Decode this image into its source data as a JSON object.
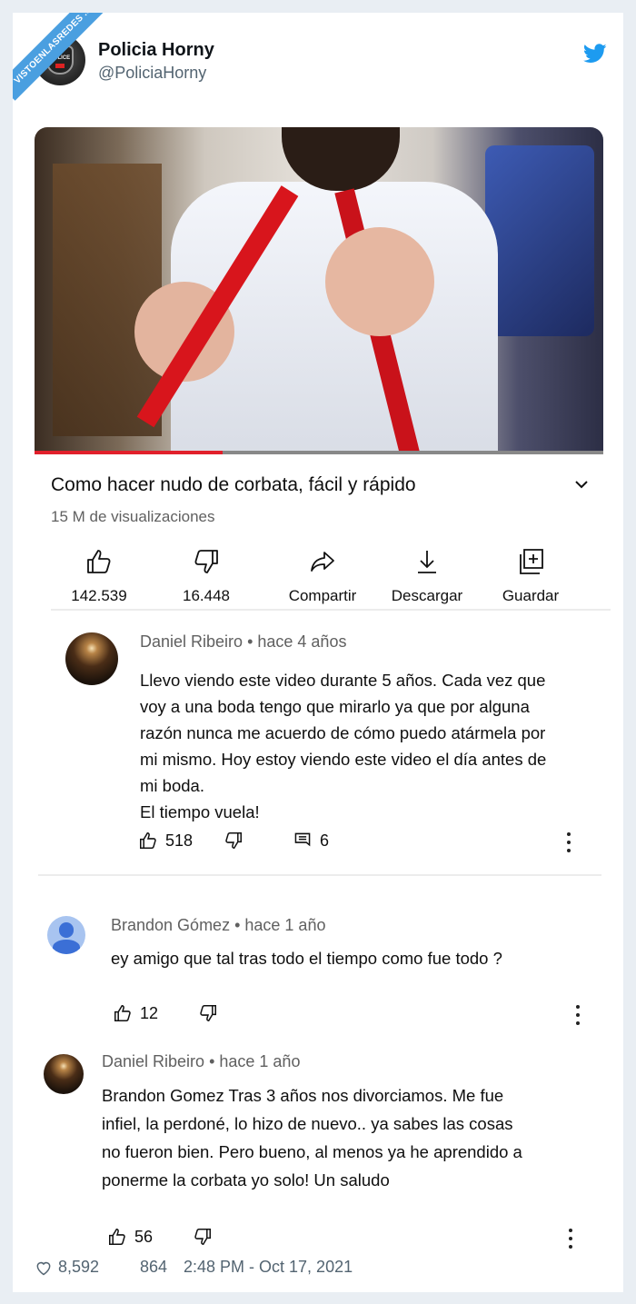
{
  "watermark": "VISTOENLASREDES .com",
  "tweet": {
    "author_name": "Policia Horny",
    "author_handle": "@PoliciaHorny",
    "avatar_badge_text": "POLICE",
    "likes": "8,592",
    "retweets": "864",
    "timestamp": "2:48 PM - Oct 17, 2021"
  },
  "video": {
    "title": "Como hacer nudo de corbata, fácil y rápido",
    "views": "15 M de visualizaciones",
    "progress": 0.33,
    "actions": [
      {
        "icon": "thumbs-up-icon",
        "label": "142.539"
      },
      {
        "icon": "thumbs-down-icon",
        "label": "16.448"
      },
      {
        "icon": "share-icon",
        "label": "Compartir"
      },
      {
        "icon": "download-icon",
        "label": "Descargar"
      },
      {
        "icon": "save-playlist-icon",
        "label": "Guardar"
      }
    ]
  },
  "comments": [
    {
      "author": "Daniel Ribeiro",
      "age": "hace 4 años",
      "text": "Llevo viendo este video durante 5 años. Cada vez que\nvoy a una boda tengo que mirarlo ya que por alguna\nrazón nunca me acuerdo de cómo puedo atármela por\nmi mismo. Hoy estoy viendo este video el día antes de\nmi boda.\nEl tiempo vuela!",
      "likes": "518",
      "replies": "6"
    },
    {
      "author": "Brandon Gómez",
      "age": "hace 1 año",
      "text": "ey amigo que tal tras todo el tiempo como fue todo ?",
      "likes": "12"
    },
    {
      "author": "Daniel Ribeiro",
      "age": "hace 1 año",
      "text": "Brandon Gomez Tras 3 años nos divorciamos. Me fue\ninfiel, la perdoné, lo hizo de nuevo.. ya sabes las cosas\nno fueron bien. Pero bueno, al menos ya he aprendido a\nponerme la corbata yo solo! Un saludo",
      "likes": "56"
    }
  ],
  "colors": {
    "twitter_blue": "#1d9bf0",
    "progress_red": "#e1202b",
    "background": "#e9eef3"
  }
}
